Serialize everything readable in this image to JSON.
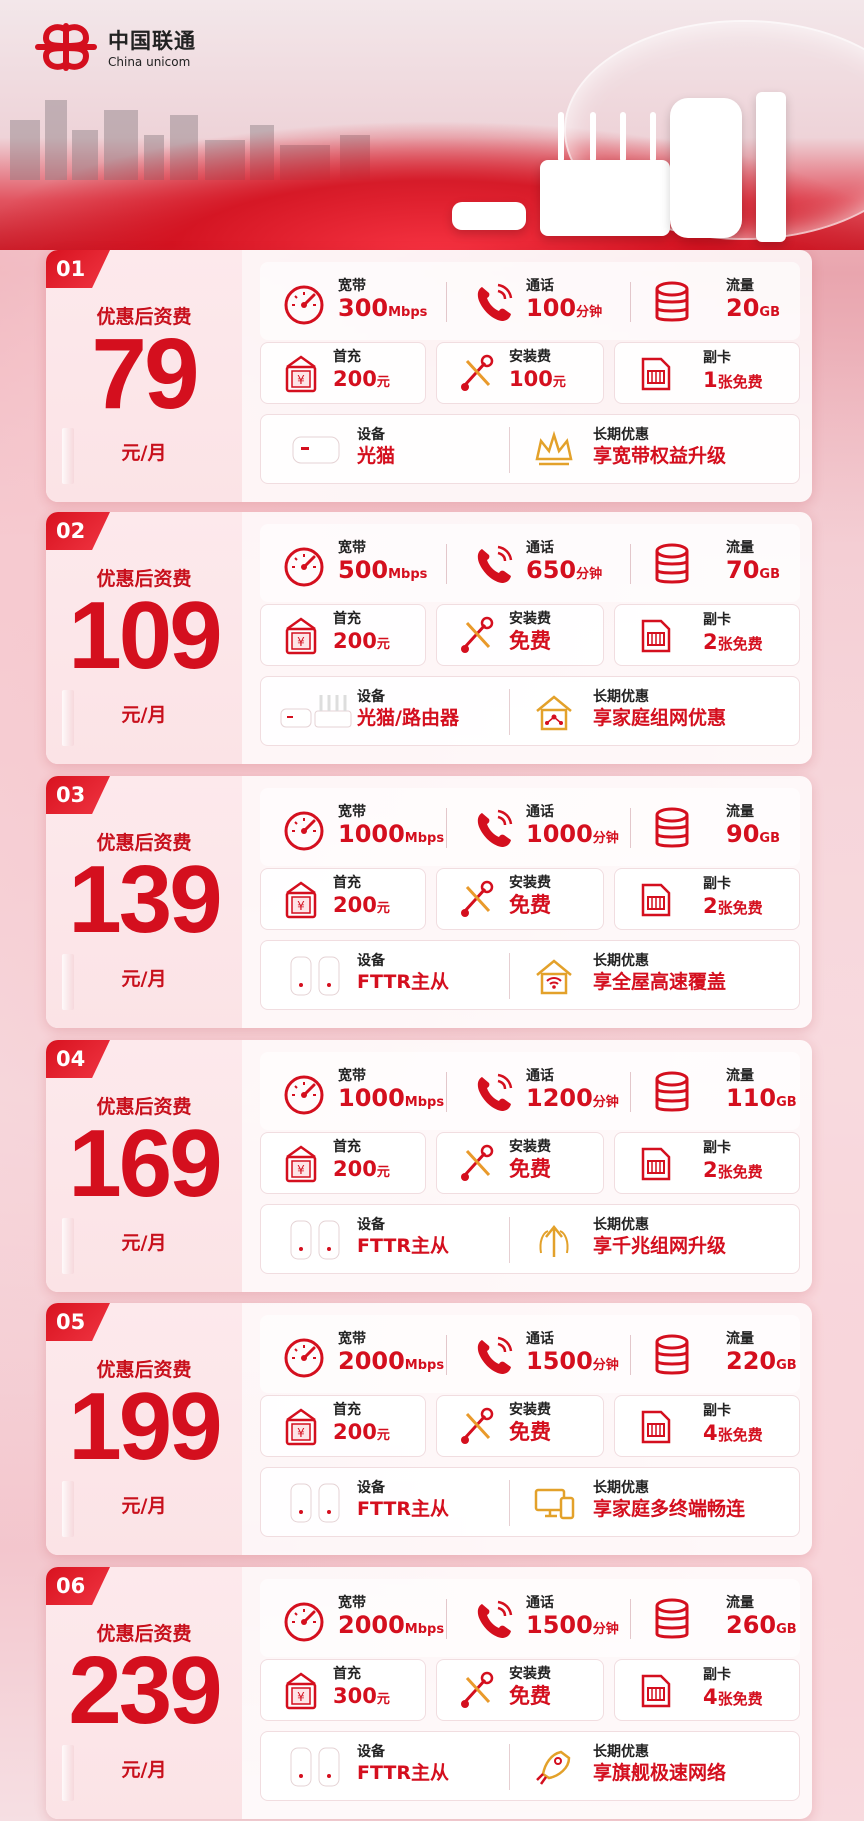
{
  "brand": {
    "name_cn": "中国联通",
    "name_en": "China unicom",
    "accent": "#d40f1e"
  },
  "labels": {
    "broadband": "宽带",
    "calls": "通话",
    "data": "流量",
    "first_recharge": "首充",
    "install_fee": "安装费",
    "sub_card": "副卡",
    "device": "设备",
    "long_term": "长期优惠",
    "pre_price": "优惠后资费",
    "unit": "元/月"
  },
  "plans": [
    {
      "no": "01",
      "price": "79",
      "bw": "300",
      "bw_unit": "Mbps",
      "call": "100",
      "call_unit": "分钟",
      "flow": "20",
      "flow_unit": "GB",
      "recharge": "200",
      "recharge_unit": "元",
      "install": "100",
      "install_unit": "元",
      "sub": "1",
      "sub_unit": "张免费",
      "device": "光猫",
      "benefit": "享宽带权益升级",
      "benefit_icon": "crown-icon"
    },
    {
      "no": "02",
      "price": "109",
      "bw": "500",
      "bw_unit": "Mbps",
      "call": "650",
      "call_unit": "分钟",
      "flow": "70",
      "flow_unit": "GB",
      "recharge": "200",
      "recharge_unit": "元",
      "install": "免费",
      "install_unit": "",
      "sub": "2",
      "sub_unit": "张免费",
      "device": "光猫/路由器",
      "benefit": "享家庭组网优惠",
      "benefit_icon": "home-network-icon"
    },
    {
      "no": "03",
      "price": "139",
      "bw": "1000",
      "bw_unit": "Mbps",
      "call": "1000",
      "call_unit": "分钟",
      "flow": "90",
      "flow_unit": "GB",
      "recharge": "200",
      "recharge_unit": "元",
      "install": "免费",
      "install_unit": "",
      "sub": "2",
      "sub_unit": "张免费",
      "device": "FTTR主从",
      "benefit": "享全屋高速覆盖",
      "benefit_icon": "wifi-home-icon"
    },
    {
      "no": "04",
      "price": "169",
      "bw": "1000",
      "bw_unit": "Mbps",
      "call": "1200",
      "call_unit": "分钟",
      "flow": "110",
      "flow_unit": "GB",
      "recharge": "200",
      "recharge_unit": "元",
      "install": "免费",
      "install_unit": "",
      "sub": "2",
      "sub_unit": "张免费",
      "device": "FTTR主从",
      "benefit": "享千兆组网升级",
      "benefit_icon": "upgrade-arrow-icon"
    },
    {
      "no": "05",
      "price": "199",
      "bw": "2000",
      "bw_unit": "Mbps",
      "call": "1500",
      "call_unit": "分钟",
      "flow": "220",
      "flow_unit": "GB",
      "recharge": "200",
      "recharge_unit": "元",
      "install": "免费",
      "install_unit": "",
      "sub": "4",
      "sub_unit": "张免费",
      "device": "FTTR主从",
      "benefit": "享家庭多终端畅连",
      "benefit_icon": "multi-device-icon"
    },
    {
      "no": "06",
      "price": "239",
      "bw": "2000",
      "bw_unit": "Mbps",
      "call": "1500",
      "call_unit": "分钟",
      "flow": "260",
      "flow_unit": "GB",
      "recharge": "300",
      "recharge_unit": "元",
      "install": "免费",
      "install_unit": "",
      "sub": "4",
      "sub_unit": "张免费",
      "device": "FTTR主从",
      "benefit": "享旗舰极速网络",
      "benefit_icon": "rocket-icon"
    }
  ]
}
